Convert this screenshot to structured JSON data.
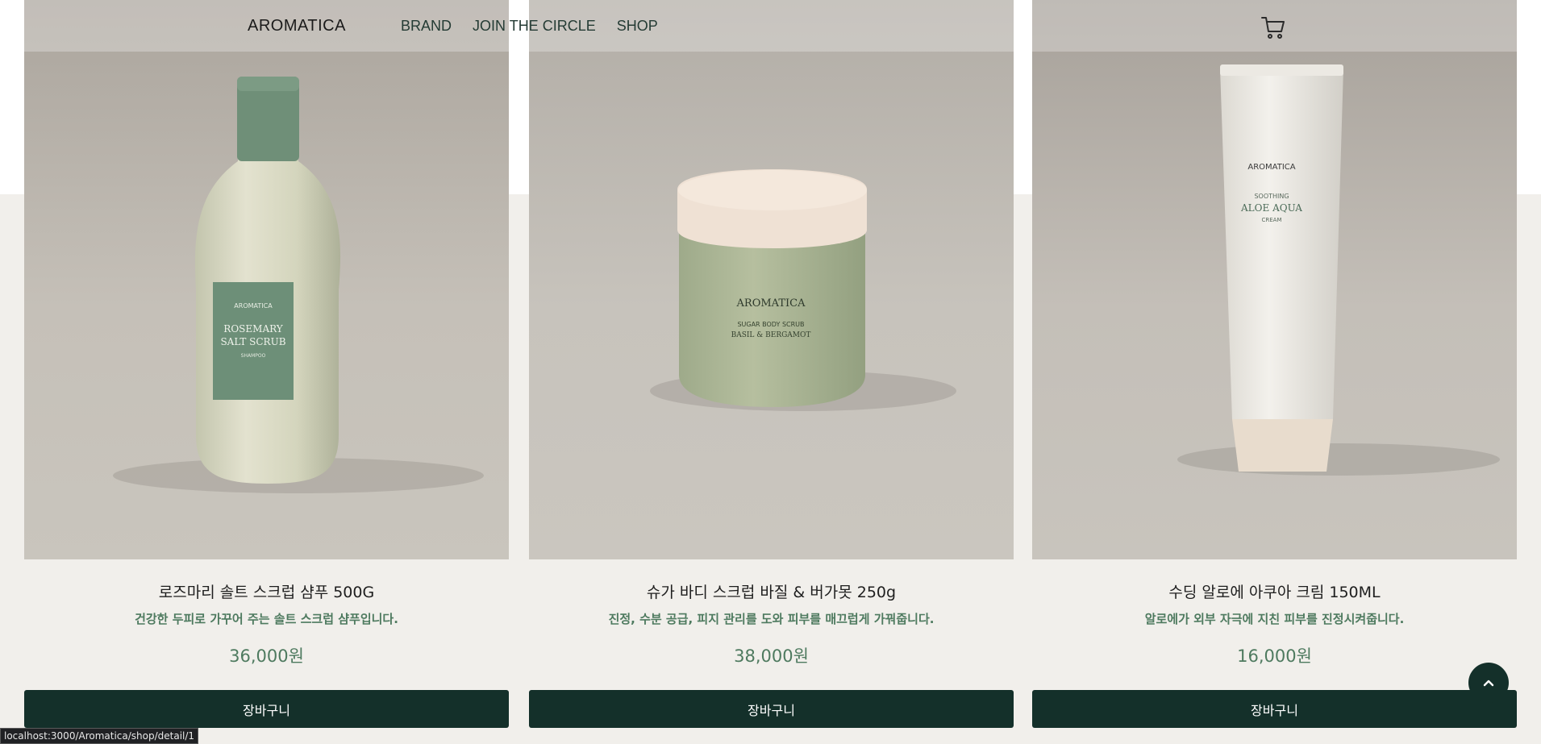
{
  "header": {
    "logo": "AROMATICA",
    "nav": [
      "BRAND",
      "JOIN THE CIRCLE",
      "SHOP"
    ],
    "cart_icon": "cart-icon"
  },
  "products": [
    {
      "name": "로즈마리 솔트 스크럽 샴푸 500G",
      "description": "건강한 두피로 가꾸어 주는 솔트 스크럽 샴푸입니다.",
      "price": "36,000원",
      "button": "장바구니",
      "label": {
        "brand": "AROMATICA",
        "line1": "ROSEMARY",
        "line2": "SALT SCRUB",
        "line3": "SHAMPOO"
      }
    },
    {
      "name": "슈가 바디 스크럽 바질 & 버가못 250g",
      "description": "진정, 수분 공급, 피지 관리를 도와 피부를 매끄럽게 가꿔줍니다.",
      "price": "38,000원",
      "button": "장바구니",
      "label": {
        "brand": "AROMATICA",
        "line1": "SUGAR BODY SCRUB",
        "line2": "BASIL & BERGAMOT"
      }
    },
    {
      "name": "수딩 알로에 아쿠아 크림 150ML",
      "description": "알로에가 외부 자극에 지친 피부를 진정시켜줍니다.",
      "price": "16,000원",
      "button": "장바구니",
      "label": {
        "brand": "AROMATICA",
        "line1": "SOOTHING",
        "line2": "ALOE AQUA",
        "line3": "CREAM"
      }
    }
  ],
  "status_url": "localhost:3000/Aromatica/shop/detail/1",
  "colors": {
    "accent_green": "#4e7a5f",
    "button_dark": "#14302a",
    "background": "#f1efeb"
  }
}
